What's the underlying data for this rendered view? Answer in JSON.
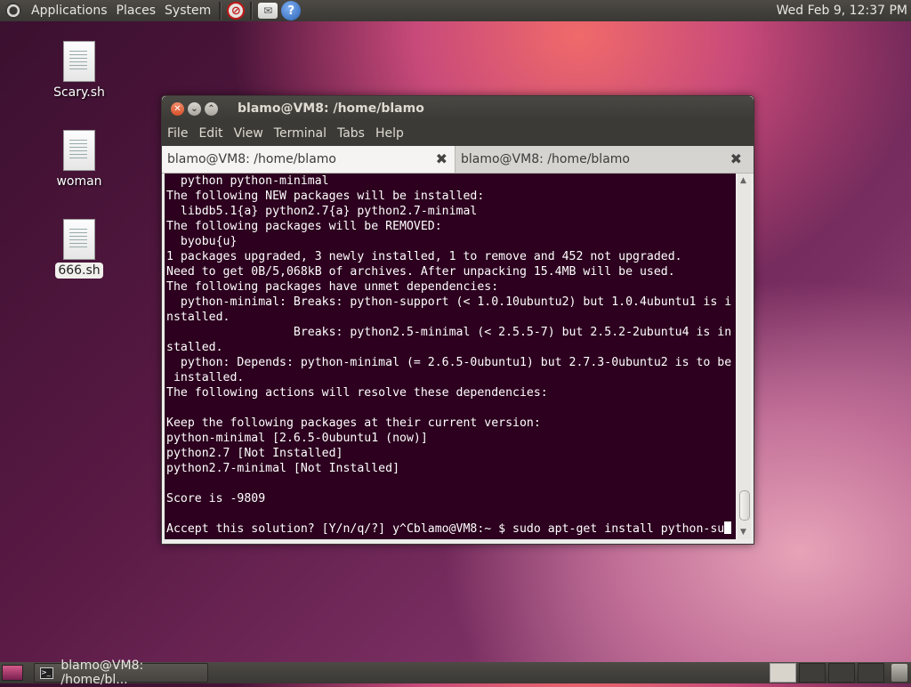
{
  "top_panel": {
    "menus": [
      "Applications",
      "Places",
      "System"
    ],
    "clock": "Wed Feb  9, 12:37 PM"
  },
  "desktop": {
    "icons": [
      {
        "label": "Scary.sh"
      },
      {
        "label": "woman"
      },
      {
        "label": "666.sh"
      }
    ]
  },
  "window": {
    "title": "blamo@VM8: /home/blamo",
    "menus": [
      "File",
      "Edit",
      "View",
      "Terminal",
      "Tabs",
      "Help"
    ],
    "tabs": [
      {
        "label": "blamo@VM8: /home/blamo"
      },
      {
        "label": "blamo@VM8: /home/blamo"
      }
    ],
    "terminal_lines": [
      "  python python-minimal",
      "The following NEW packages will be installed:",
      "  libdb5.1{a} python2.7{a} python2.7-minimal",
      "The following packages will be REMOVED:",
      "  byobu{u}",
      "1 packages upgraded, 3 newly installed, 1 to remove and 452 not upgraded.",
      "Need to get 0B/5,068kB of archives. After unpacking 15.4MB will be used.",
      "The following packages have unmet dependencies:",
      "  python-minimal: Breaks: python-support (< 1.0.10ubuntu2) but 1.0.4ubuntu1 is i",
      "nstalled.",
      "                  Breaks: python2.5-minimal (< 2.5.5-7) but 2.5.2-2ubuntu4 is in",
      "stalled.",
      "  python: Depends: python-minimal (= 2.6.5-0ubuntu1) but 2.7.3-0ubuntu2 is to be",
      " installed.",
      "The following actions will resolve these dependencies:",
      "",
      "Keep the following packages at their current version:",
      "python-minimal [2.6.5-0ubuntu1 (now)]",
      "python2.7 [Not Installed]",
      "python2.7-minimal [Not Installed]",
      "",
      "Score is -9809",
      ""
    ],
    "prompt_line": "Accept this solution? [Y/n/q/?] y^Cblamo@VM8:~ $ sudo apt-get install python-su"
  },
  "bottom_panel": {
    "task": "blamo@VM8: /home/bl..."
  }
}
